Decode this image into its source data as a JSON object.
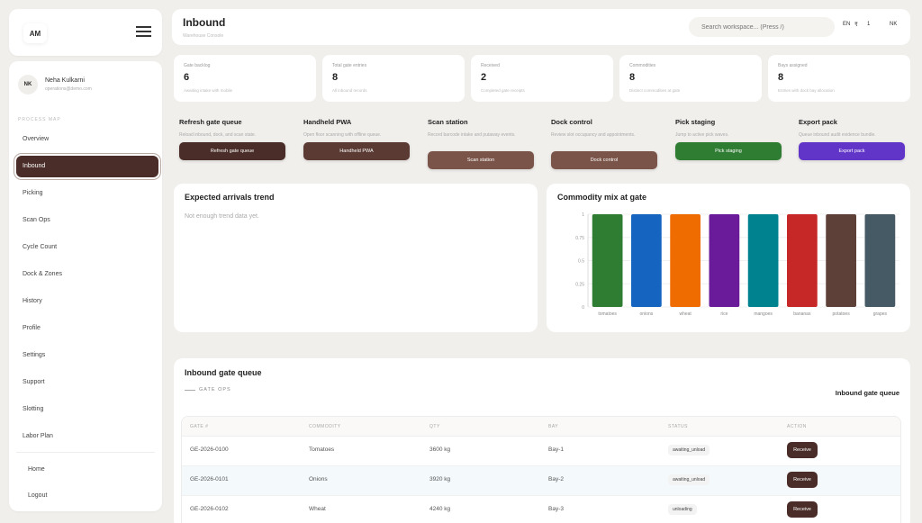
{
  "brand": {
    "initials": "AM"
  },
  "user": {
    "initials": "NK",
    "name": "Neha Kulkarni",
    "email": "operations@demo.com"
  },
  "sidebar": {
    "section_label": "PROCESS MAP",
    "items": [
      {
        "label": "Overview"
      },
      {
        "label": "Inbound",
        "active": true
      },
      {
        "label": "Picking"
      },
      {
        "label": "Scan Ops"
      },
      {
        "label": "Cycle Count"
      },
      {
        "label": "Dock & Zones"
      },
      {
        "label": "History"
      },
      {
        "label": "Profile"
      },
      {
        "label": "Settings"
      },
      {
        "label": "Support"
      },
      {
        "label": "Slotting"
      },
      {
        "label": "Labor Plan"
      }
    ],
    "footer": [
      {
        "label": "Home"
      },
      {
        "label": "Logout"
      }
    ]
  },
  "header": {
    "title": "Inbound",
    "subtitle": "Warehouse Console",
    "search_placeholder": "Search workspace... (Press /)",
    "lang": "EN",
    "currency": "₹",
    "count": "1",
    "user_initials": "NK"
  },
  "kpis": [
    {
      "label": "Gate backlog",
      "value": "6",
      "sub": "Awaiting intake with mobile"
    },
    {
      "label": "Total gate entries",
      "value": "8",
      "sub": "All inbound records"
    },
    {
      "label": "Received",
      "value": "2",
      "sub": "Completed gate receipts"
    },
    {
      "label": "Commodities",
      "value": "8",
      "sub": "Distinct commodities at gate"
    },
    {
      "label": "Bays assigned",
      "value": "8",
      "sub": "Entries with dock bay allocation"
    }
  ],
  "actions": [
    {
      "title": "Refresh gate queue",
      "desc": "Reload inbound, dock, and scan state.",
      "button": "Refresh gate queue",
      "color": "#4a2d28"
    },
    {
      "title": "Handheld PWA",
      "desc": "Open floor scanning with offline queue.",
      "button": "Handheld PWA",
      "color": "#5a3a33"
    },
    {
      "title": "Scan station",
      "desc": "Record barcode intake and putaway events.",
      "button": "Scan station",
      "color": "#7a5448"
    },
    {
      "title": "Dock control",
      "desc": "Review slot occupancy and appointments.",
      "button": "Dock control",
      "color": "#7a5448"
    },
    {
      "title": "Pick staging",
      "desc": "Jump to active pick waves.",
      "button": "Pick staging",
      "color": "#2e7d32"
    },
    {
      "title": "Export pack",
      "desc": "Queue inbound audit evidence bundle.",
      "button": "Export pack",
      "color": "#6235c9"
    }
  ],
  "trend_panel": {
    "title": "Expected arrivals trend",
    "empty": "Not enough trend data yet."
  },
  "commodity_panel": {
    "title": "Commodity mix at gate"
  },
  "chart_data": {
    "type": "bar",
    "title": "Commodity mix at gate",
    "categories": [
      "tomatoes",
      "onions",
      "wheat",
      "rice",
      "mangoes",
      "bananas",
      "potatoes",
      "grapes"
    ],
    "values": [
      1,
      1,
      1,
      1,
      1,
      1,
      1,
      1
    ],
    "colors": [
      "#2e7d32",
      "#1565c0",
      "#ef6c00",
      "#6a1b9a",
      "#00838f",
      "#c62828",
      "#5d4037",
      "#455a64"
    ],
    "yticks": [
      "0",
      "0.25",
      "0.5",
      "0.75",
      "1"
    ],
    "ylim": [
      0,
      1
    ],
    "grid": true
  },
  "queue": {
    "title": "Inbound gate queue",
    "tag": "GATE OPS",
    "right_title": "Inbound gate queue",
    "columns": [
      "GATE #",
      "COMMODITY",
      "QTY",
      "BAY",
      "STATUS",
      "ACTION"
    ],
    "rows": [
      {
        "gate": "GE-2026-0100",
        "commodity": "Tomatoes",
        "qty": "3600 kg",
        "bay": "Bay-1",
        "status": "awaiting_unload",
        "action": "Receive"
      },
      {
        "gate": "GE-2026-0101",
        "commodity": "Onions",
        "qty": "3920 kg",
        "bay": "Bay-2",
        "status": "awaiting_unload",
        "action": "Receive"
      },
      {
        "gate": "GE-2026-0102",
        "commodity": "Wheat",
        "qty": "4240 kg",
        "bay": "Bay-3",
        "status": "unloading",
        "action": "Receive"
      }
    ]
  }
}
